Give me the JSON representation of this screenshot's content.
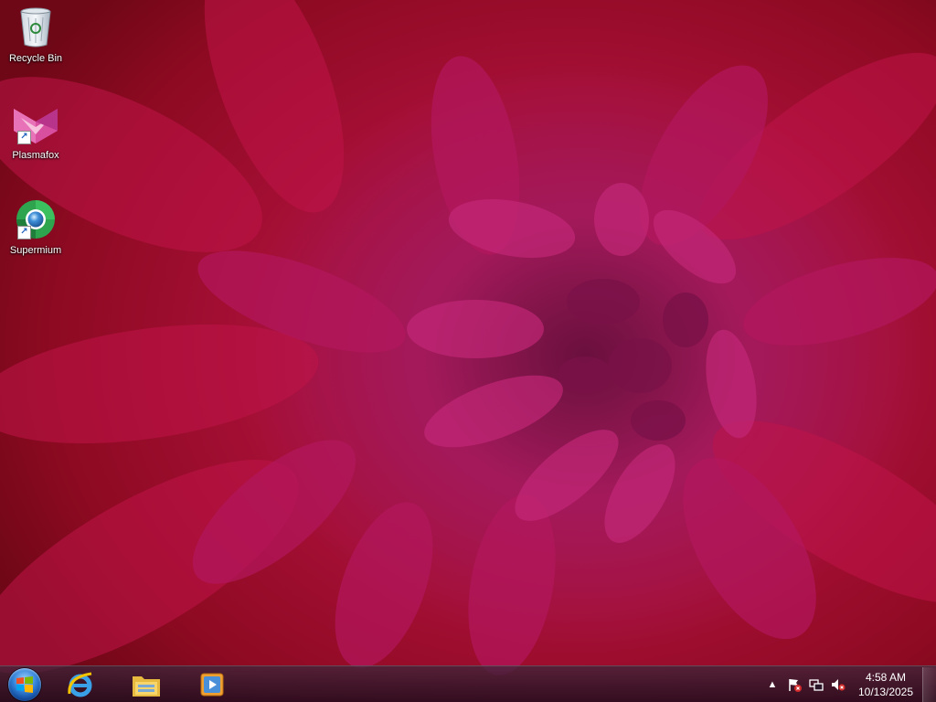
{
  "desktop": {
    "icons": [
      {
        "label": "Recycle Bin",
        "icon": "recycle-bin-icon",
        "shortcut": false
      },
      {
        "label": "Plasmafox",
        "icon": "plasmafox-icon",
        "shortcut": true
      },
      {
        "label": "Supermium",
        "icon": "supermium-icon",
        "shortcut": true
      }
    ]
  },
  "taskbar": {
    "start_icon": "windows-start-orb",
    "pinned": [
      {
        "icon": "internet-explorer-icon"
      },
      {
        "icon": "file-explorer-icon"
      },
      {
        "icon": "media-player-icon"
      }
    ],
    "tray": {
      "icons": [
        "show-hidden-icons-arrow",
        "action-center-flag-icon",
        "network-icon",
        "volume-muted-icon"
      ],
      "arrow_glyph": "▲",
      "time": "4:58 AM",
      "date": "10/13/2025"
    }
  },
  "colors": {
    "wallpaper_primary": "#a50f35",
    "wallpaper_center": "#7f1448",
    "taskbar": "#2a1628"
  }
}
